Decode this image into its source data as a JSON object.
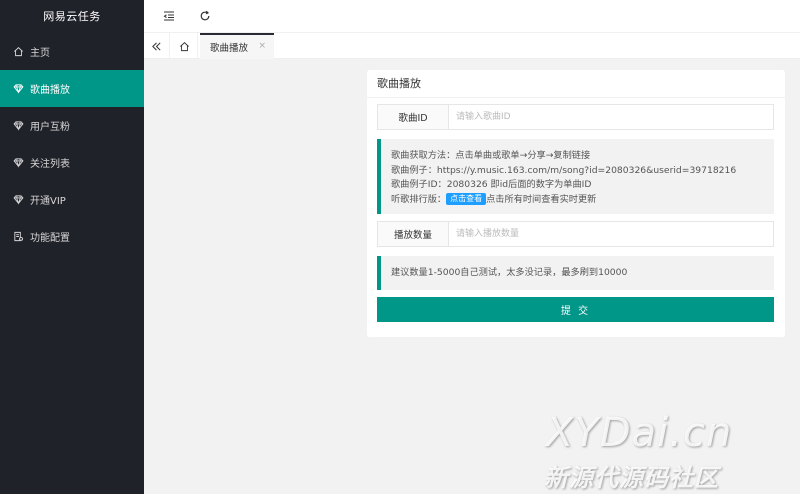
{
  "brand": "网易云任务",
  "sidebar": {
    "items": [
      {
        "label": "主页",
        "icon": "home-icon"
      },
      {
        "label": "歌曲播放",
        "icon": "diamond-icon",
        "active": true
      },
      {
        "label": "用户互粉",
        "icon": "diamond-icon"
      },
      {
        "label": "关注列表",
        "icon": "diamond-icon"
      },
      {
        "label": "开通VIP",
        "icon": "diamond-icon"
      },
      {
        "label": "功能配置",
        "icon": "settings-doc-icon"
      }
    ]
  },
  "header": {
    "menu_toggle_icon": "indent-icon",
    "refresh_icon": "refresh-icon"
  },
  "tabs": {
    "back_icon": "double-chevron-left-icon",
    "home_icon": "home-icon",
    "items": [
      {
        "label": "歌曲播放",
        "close": "×"
      }
    ]
  },
  "card": {
    "title": "歌曲播放",
    "song_id": {
      "label": "歌曲ID",
      "placeholder": "请输入歌曲ID",
      "value": ""
    },
    "info": {
      "line1": "歌曲获取方法：点击单曲或歌单→分享→复制链接",
      "line2": "歌曲例子：https://y.music.163.com/m/song?id=2080326&userid=39718216",
      "line3": "歌曲例子ID：2080326 即id后面的数字为单曲ID",
      "line4_prefix": "听歌排行版：",
      "line4_button": "点击查看",
      "line4_suffix": "点击所有时间查看实时更新"
    },
    "play_count": {
      "label": "播放数量",
      "placeholder": "请输入播放数量",
      "value": ""
    },
    "note": "建议数量1-5000自己测试，太多没记录，最多刷到10000",
    "submit_label": "提 交"
  },
  "watermark": {
    "top": "XYDai.cn",
    "bottom": "新源代源码社区"
  },
  "colors": {
    "sidebar_bg": "#20222a",
    "accent": "#009688",
    "link_button": "#1e9fff",
    "page_bg": "#f2f2f2"
  }
}
